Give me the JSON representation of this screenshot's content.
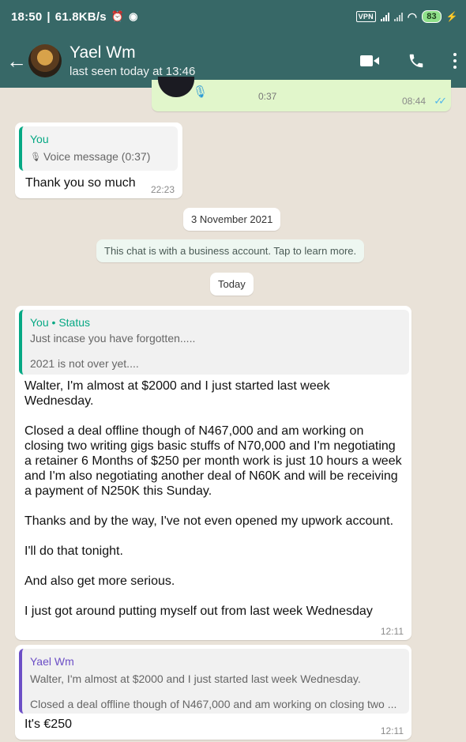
{
  "status_bar": {
    "time": "18:50",
    "speed": "61.8KB/s",
    "vpn": "VPN",
    "battery": "83"
  },
  "header": {
    "contact_name": "Yael Wm",
    "last_seen": "last seen today at 13:46"
  },
  "voice_bubble": {
    "duration": "0:37",
    "time": "08:44"
  },
  "msg_thanks": {
    "quote_sender": "You",
    "quote_text": "Voice message (0:37)",
    "text": "Thank you so much",
    "time": "22:23"
  },
  "date_pill": "3 November 2021",
  "business_notice": "This chat is with a business account. Tap to learn more.",
  "today_pill": "Today",
  "msg_long": {
    "quote_sender": "You",
    "quote_suffix": "Status",
    "quote_line1": "Just incase you have forgotten.....",
    "quote_line2": "2021 is not over yet....",
    "para1": "Walter, I'm almost at $2000 and I just started last week Wednesday.",
    "para2": "Closed a deal offline though of N467,000 and am working on closing two writing gigs basic stuffs of N70,000 and I'm negotiating a retainer 6 Months of $250 per month work is just 10 hours a week and I'm also negotiating another deal of N60K and will be receiving a payment of N250K this Sunday.",
    "para3": "Thanks and by the way, I've not even opened my upwork account.",
    "para4": "I'll do that tonight.",
    "para5": "And also get more serious.",
    "para6": "I just got around putting myself out from last week Wednesday",
    "time": "12:11"
  },
  "msg_last": {
    "quote_sender": "Yael Wm",
    "quote_line1": "Walter, I'm almost at $2000 and I just started last week Wednesday.",
    "quote_line2": "Closed a deal offline though of N467,000 and am working on closing two ...",
    "text": "It's €250",
    "time": "12:11"
  },
  "colors": {
    "header_bg": "#376867",
    "chat_bg": "#e9e2d8",
    "accent_green": "#06a884",
    "accent_purple": "#6c4fc6",
    "outgoing_bubble": "#e1f6cb"
  }
}
